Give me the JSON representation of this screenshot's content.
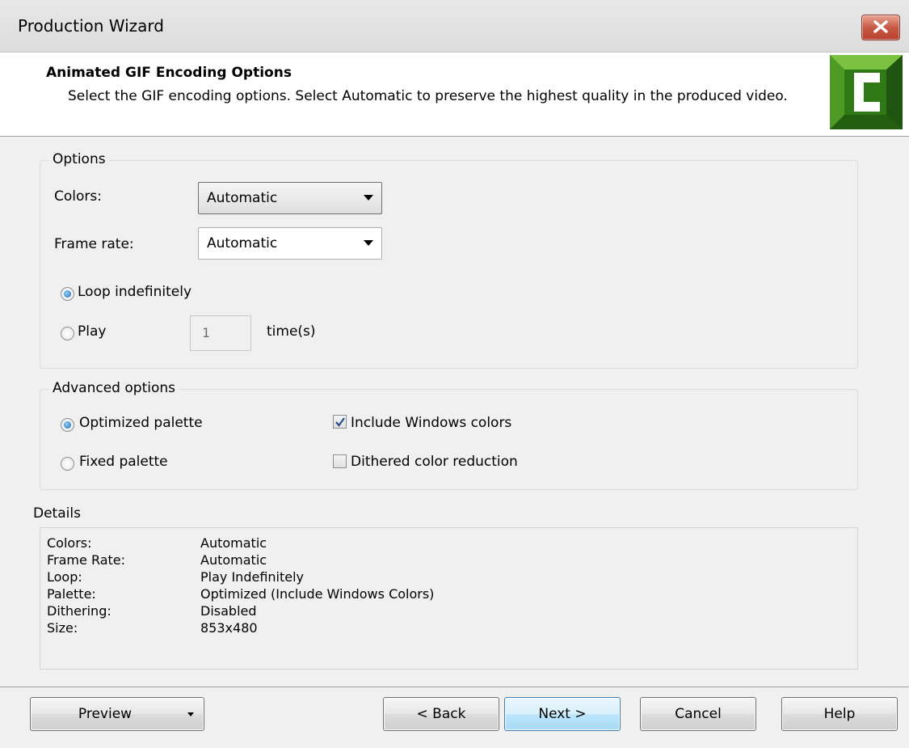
{
  "window": {
    "title": "Production Wizard"
  },
  "header": {
    "title": "Animated GIF Encoding Options",
    "description": "Select the GIF encoding options. Select Automatic to preserve the highest quality in the produced video."
  },
  "options": {
    "group_label": "Options",
    "colors_label": "Colors:",
    "colors_value": "Automatic",
    "frame_rate_label": "Frame rate:",
    "frame_rate_value": "Automatic",
    "loop_label": "Loop indefinitely",
    "play_label": "Play",
    "play_count": "1",
    "times_label": "time(s)"
  },
  "advanced": {
    "group_label": "Advanced options",
    "optimized_palette": "Optimized palette",
    "fixed_palette": "Fixed palette",
    "include_windows_colors": "Include Windows colors",
    "dithered": "Dithered color reduction"
  },
  "details": {
    "label": "Details",
    "rows": [
      {
        "key": "Colors:",
        "value": "Automatic"
      },
      {
        "key": "Frame Rate:",
        "value": "Automatic"
      },
      {
        "key": "Loop:",
        "value": "Play Indefinitely"
      },
      {
        "key": "Palette:",
        "value": "Optimized (Include Windows Colors)"
      },
      {
        "key": "Dithering:",
        "value": "Disabled"
      },
      {
        "key": "Size:",
        "value": "853x480"
      }
    ]
  },
  "buttons": {
    "preview": "Preview",
    "back": "< Back",
    "next": "Next >",
    "cancel": "Cancel",
    "help": "Help"
  },
  "colors": {
    "logo_green": "#3f8f1f",
    "selected_button_blue": "#3c7fb1"
  }
}
